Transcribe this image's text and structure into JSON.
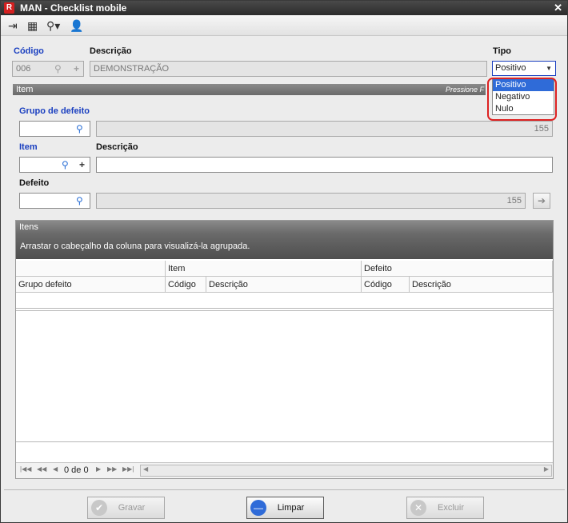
{
  "window": {
    "title": "MAN - Checklist mobile",
    "app_icon": "R"
  },
  "toolbar": {
    "icons": [
      "exit-icon",
      "card-icon",
      "search-icon",
      "user-icon"
    ]
  },
  "header": {
    "codigo_label": "Código",
    "codigo_value": "006",
    "descricao_label": "Descrição",
    "descricao_value": "DEMONSTRAÇÃO",
    "tipo_label": "Tipo",
    "tipo_value": "Positivo",
    "tipo_options": [
      "Positivo",
      "Negativo",
      "Nulo"
    ]
  },
  "item_section": {
    "title": "Item",
    "hint": "Pressione F",
    "grupo_label": "Grupo de defeito",
    "grupo_desc_value": "155",
    "item_label": "Item",
    "item_desc_label": "Descrição",
    "defeito_label": "Defeito",
    "defeito_desc_value": "155"
  },
  "itens_grid": {
    "title": "Itens",
    "group_hint": "Arrastar o cabeçalho da coluna para visualizá-la agrupada.",
    "band_item": "Item",
    "band_defeito": "Defeito",
    "columns": [
      "Grupo defeito",
      "Código",
      "Descrição",
      "Código",
      "Descrição"
    ],
    "pager_text": "0 de 0"
  },
  "footer": {
    "gravar": "Gravar",
    "limpar": "Limpar",
    "excluir": "Excluir"
  },
  "colors": {
    "accent": "#1a3fc0",
    "highlight": "#dd2222",
    "selection": "#2f6bd8"
  }
}
